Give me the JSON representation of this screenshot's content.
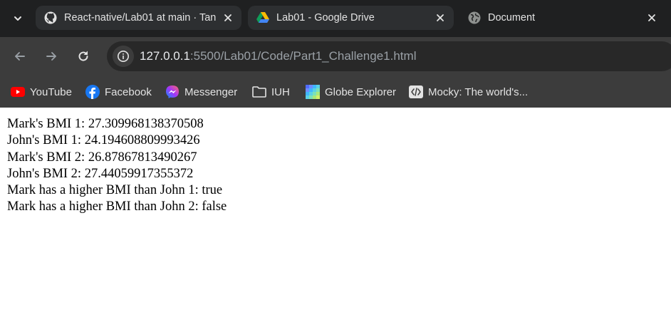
{
  "browser": {
    "tabs": [
      {
        "title": "React-native/Lab01 at main · Tan",
        "icon": "github-icon",
        "active": false
      },
      {
        "title": "Lab01 - Google Drive",
        "icon": "google-drive-icon",
        "active": false
      },
      {
        "title": "Document",
        "icon": "globe-icon",
        "active": true
      }
    ],
    "omnibox": {
      "url_host": "127.0.0.1",
      "url_rest": ":5500/Lab01/Code/Part1_Challenge1.html"
    },
    "bookmarks": [
      {
        "label": "YouTube",
        "icon": "youtube-icon"
      },
      {
        "label": "Facebook",
        "icon": "facebook-icon"
      },
      {
        "label": "Messenger",
        "icon": "messenger-icon"
      },
      {
        "label": "IUH",
        "icon": "folder-icon"
      },
      {
        "label": "Globe Explorer",
        "icon": "globe-explorer-icon"
      },
      {
        "label": "Mocky: The world's...",
        "icon": "mocky-icon"
      }
    ]
  },
  "page": {
    "lines": [
      "Mark's BMI 1: 27.309968138370508",
      "John's BMI 1: 24.194608809993426",
      "Mark's BMI 2: 26.87867813490267",
      "John's BMI 2: 27.44059917355372",
      "Mark has a higher BMI than John 1: true",
      "Mark has a higher BMI than John 2: false"
    ]
  },
  "colors": {
    "tabstrip_bg": "#1f2021",
    "toolbar_bg": "#3c3c3c",
    "omnibox_bg": "#282828",
    "page_bg": "#ffffff"
  }
}
